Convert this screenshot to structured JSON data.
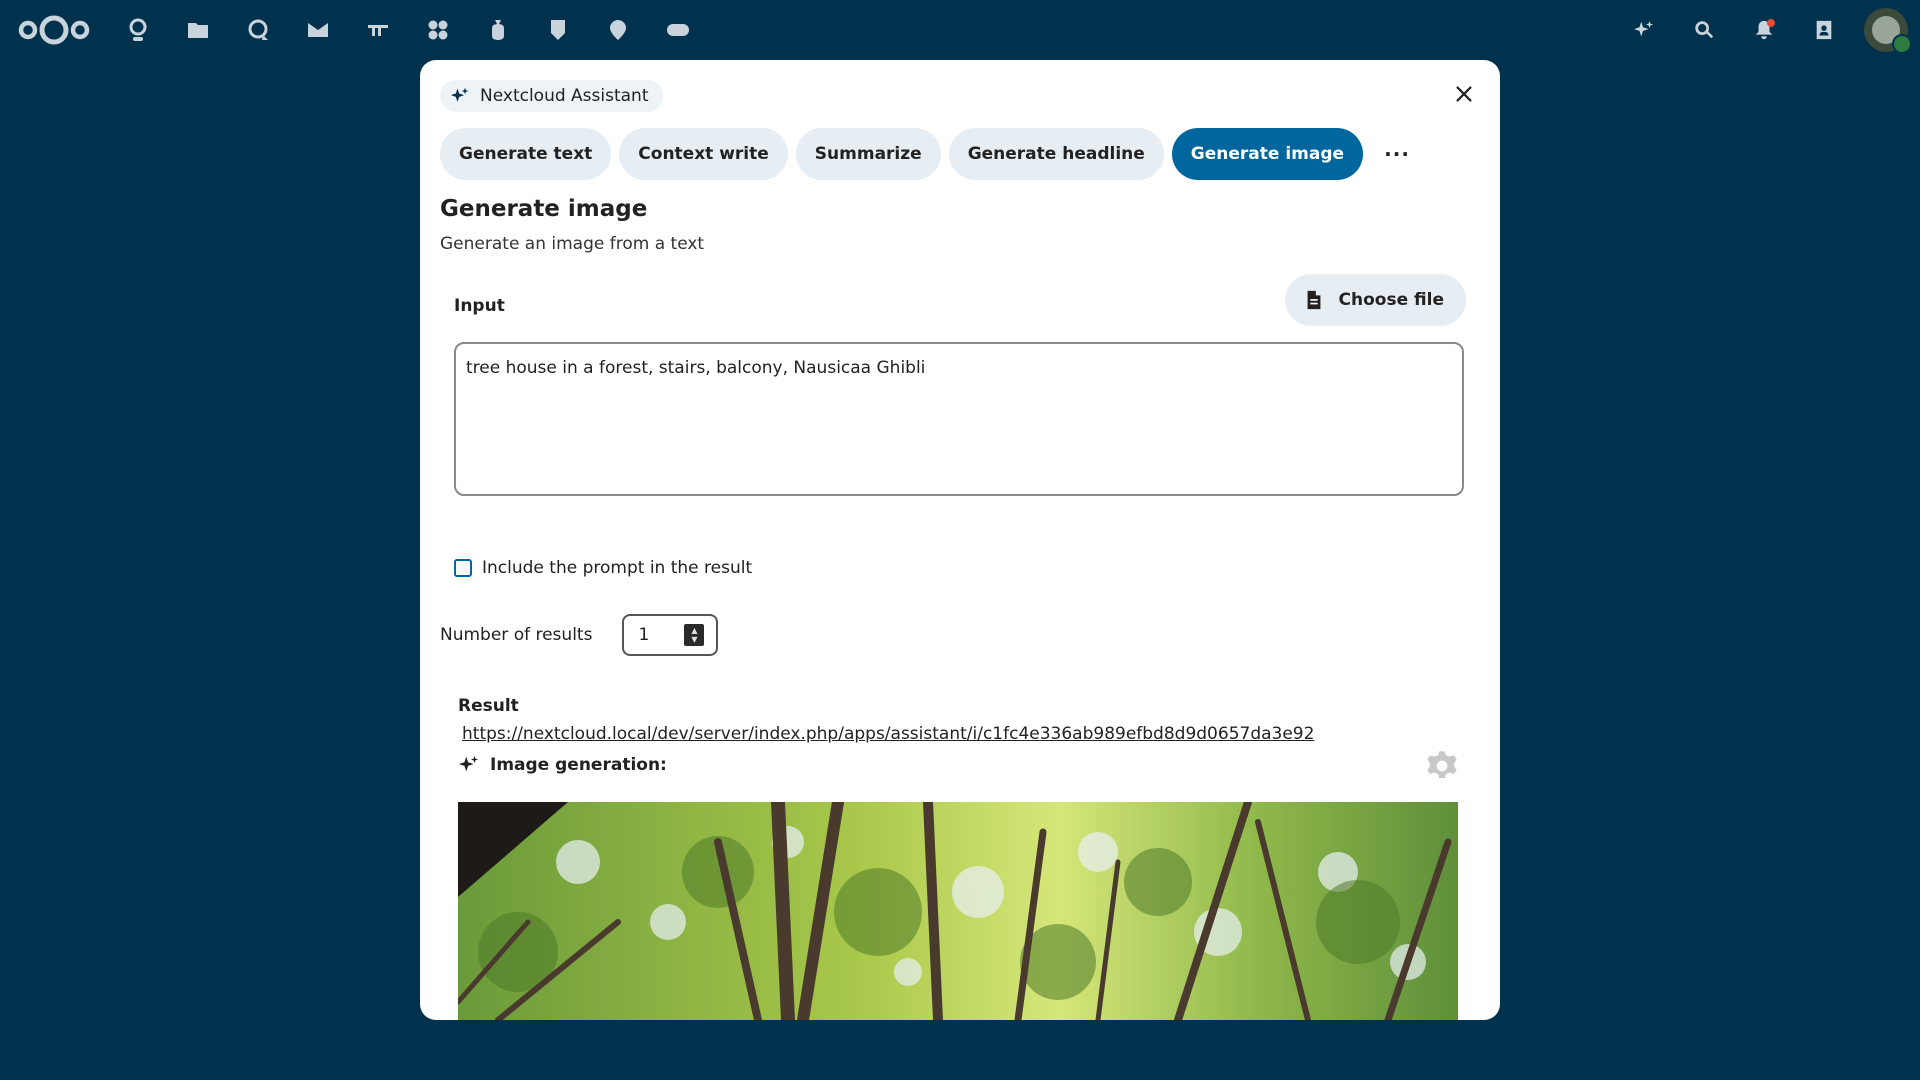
{
  "topbar": {
    "apps": [
      "dashboard-icon",
      "files-icon",
      "talk-icon",
      "mail-icon",
      "deck-icon",
      "apps-icon",
      "money-icon",
      "maps-icon",
      "location-icon",
      "ocs-icon"
    ],
    "right": [
      "assistant-icon",
      "search-icon",
      "notifications-icon",
      "contacts-icon"
    ]
  },
  "modal": {
    "app_name": "Nextcloud Assistant",
    "tabs": [
      {
        "label": "Generate text"
      },
      {
        "label": "Context write"
      },
      {
        "label": "Summarize"
      },
      {
        "label": "Generate headline"
      },
      {
        "label": "Generate image"
      }
    ],
    "more_label": "···",
    "active_tab": "Generate image",
    "title": "Generate image",
    "description": "Generate an image from a text",
    "input_label": "Input",
    "choose_file_label": "Choose file",
    "input_value": "tree house in a forest, stairs, balcony, Nausicaa Ghibli",
    "include_prompt_label": "Include the prompt in the result",
    "include_prompt_checked": false,
    "number_of_results_label": "Number of results",
    "number_of_results_value": "1",
    "result_label": "Result",
    "result_link": "https://nextcloud.local/dev/server/index.php/apps/assistant/i/c1fc4e336ab989efbd8d9d0657da3e92",
    "image_generation_label": "Image generation:"
  },
  "colors": {
    "background": "#00324e",
    "primary": "#00679e",
    "tab_bg": "#e6edf3"
  }
}
